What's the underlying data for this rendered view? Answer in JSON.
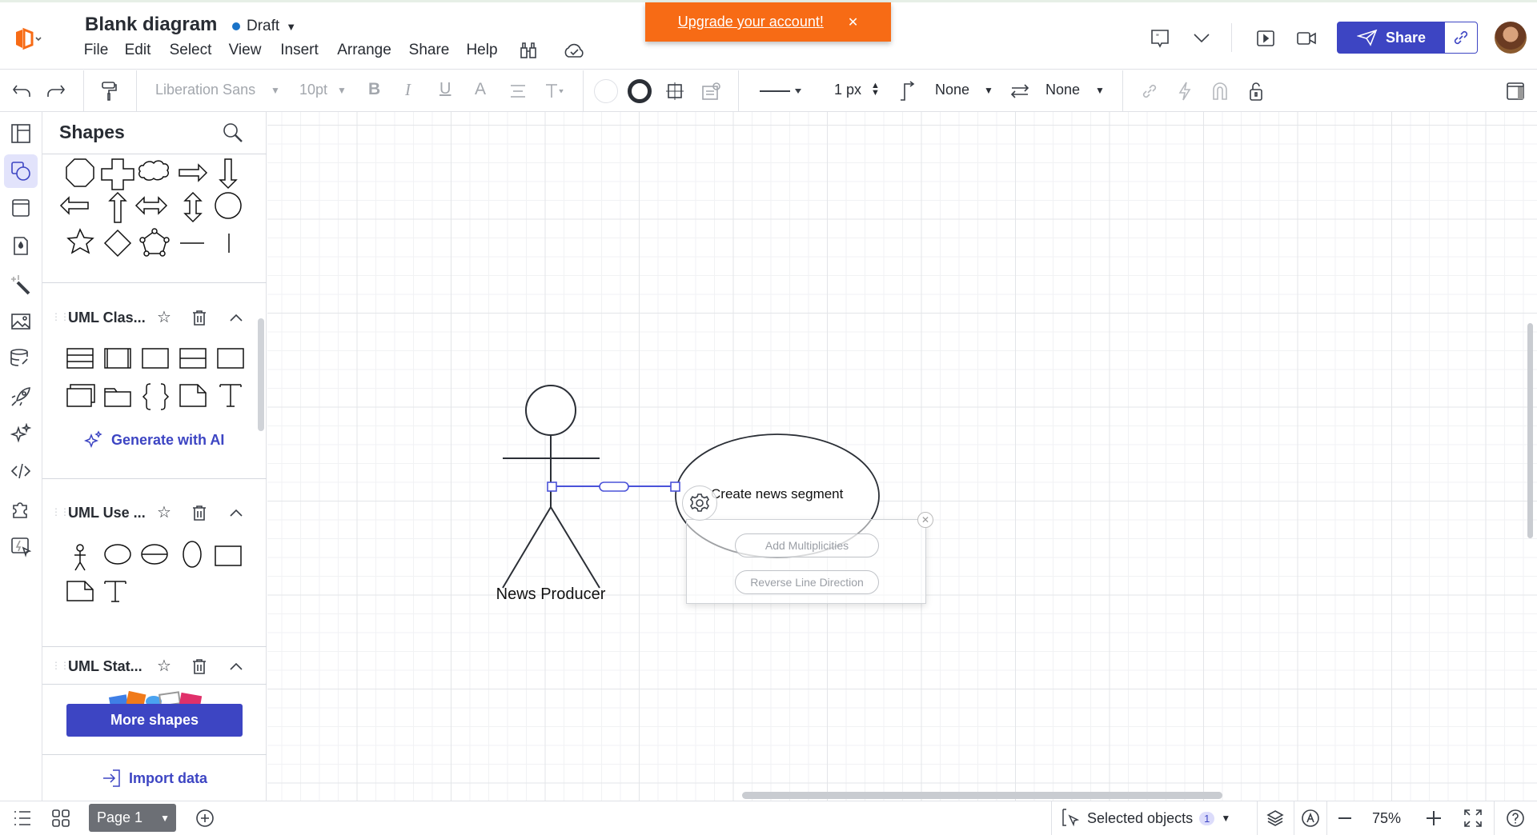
{
  "header": {
    "title": "Blank diagram",
    "status": "Draft",
    "menu": [
      "File",
      "Edit",
      "Select",
      "View",
      "Insert",
      "Arrange",
      "Share",
      "Help"
    ],
    "upgrade": "Upgrade your account!",
    "share": "Share"
  },
  "toolbar": {
    "font": "Liberation Sans",
    "size": "10pt",
    "bold": "B",
    "italic": "I",
    "underline": "U",
    "color": "A",
    "line_width": "1 px",
    "start_arrow": "None",
    "end_arrow": "None"
  },
  "panel": {
    "title": "Shapes",
    "sections": [
      {
        "name": "UML Clas..."
      },
      {
        "name": "UML Use ..."
      },
      {
        "name": "UML Stat..."
      }
    ],
    "generate": "Generate with AI",
    "more": "More shapes",
    "import": "Import data"
  },
  "canvas": {
    "actor": "News Producer",
    "usecase": "Create news segment",
    "popup": {
      "add": "Add Multiplicities",
      "reverse": "Reverse Line Direction"
    }
  },
  "footer": {
    "page": "Page 1",
    "selected": "Selected objects",
    "count": "1",
    "zoom": "75%"
  },
  "colors": {
    "accent": "#3d45c3",
    "upgrade": "#f76b15",
    "selection": "#4a52d9"
  }
}
